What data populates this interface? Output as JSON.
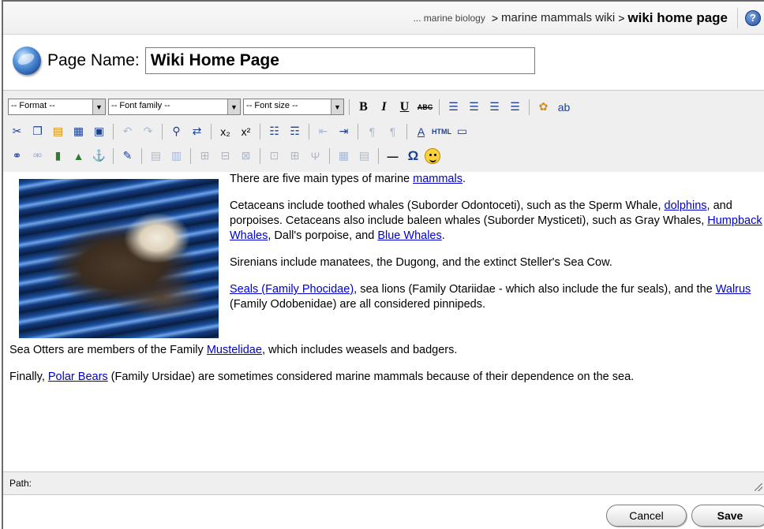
{
  "breadcrumb": {
    "trail": "... marine biology",
    "parent": "marine mammals wiki",
    "current": "wiki home page",
    "separator": ">"
  },
  "help_icon": "help-icon",
  "page_name": {
    "label": "Page Name:",
    "value": "Wiki Home Page"
  },
  "toolbar": {
    "format_select": "-- Format --",
    "font_family_select": "-- Font family --",
    "font_size_select": "-- Font size --",
    "bold": "B",
    "italic": "I",
    "underline": "U",
    "strike": "ABC",
    "html": "HTML",
    "omega": "Ω",
    "hr": "—"
  },
  "content": {
    "p1_text": "There are five main types of marine ",
    "p1_link": "mammals",
    "p1_end": ".",
    "p2_a": "Cetaceans include toothed whales (Suborder Odontoceti), such as the Sperm Whale, ",
    "p2_link1": "dolphins",
    "p2_b": ", and porpoises. Cetaceans also include baleen whales (Suborder Mysticeti), such as Gray Whales, ",
    "p2_link2": "Humpback Whales",
    "p2_c": ", Dall's porpoise, and ",
    "p2_link3": "Blue Whales",
    "p2_d": ".",
    "p3": "Sirenians include manatees, the Dugong, and the extinct Steller's Sea Cow.",
    "p4_link1": "Seals (Family Phocidae)",
    "p4_a": ", sea lions (Family Otariidae - which also include the fur seals), and the ",
    "p4_link2": "Walrus",
    "p4_b": " (Family Odobenidae) are all considered pinnipeds.",
    "p5_a": "Sea Otters are members of the Family ",
    "p5_link": "Mustelidae",
    "p5_b": ", which includes weasels and badgers.",
    "p6_a": "Finally, ",
    "p6_link": "Polar Bears",
    "p6_b": " (Family Ursidae) are sometimes considered marine mammals because of their dependence on the sea."
  },
  "path_label": "Path:",
  "buttons": {
    "cancel": "Cancel",
    "save": "Save"
  }
}
